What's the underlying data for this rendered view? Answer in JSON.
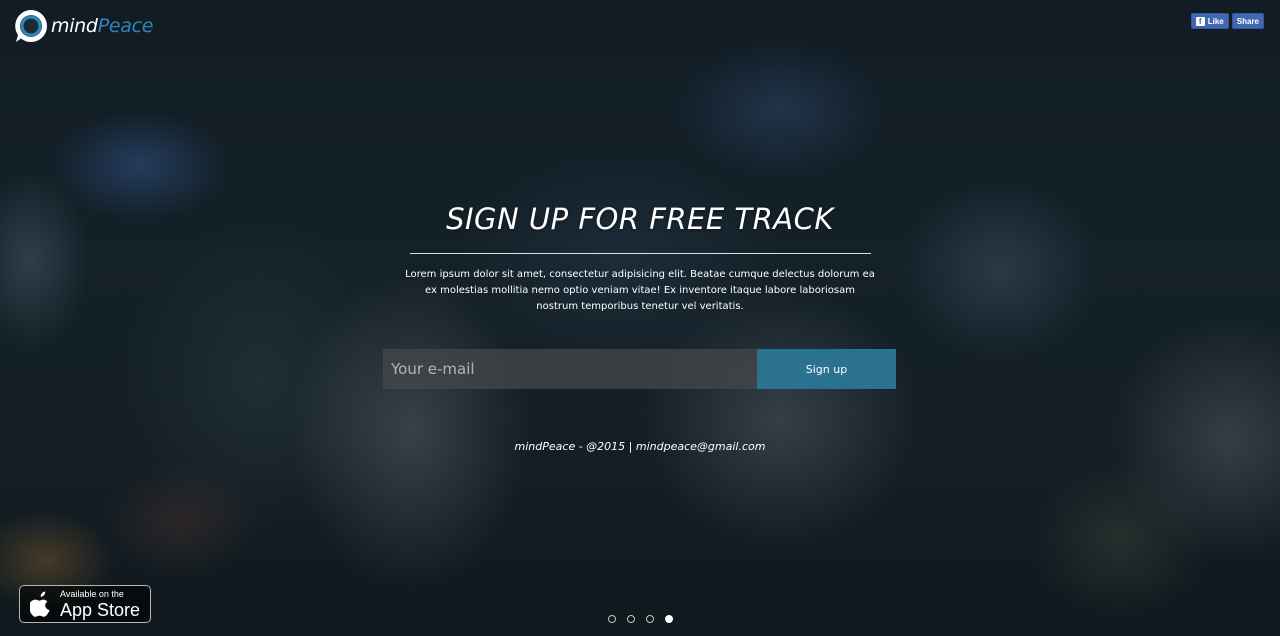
{
  "brand": {
    "name_part1": "mind",
    "name_part2": "Peace",
    "logo_icon": "speech-bubble-ring-logo",
    "accent_color": "#2e86b8"
  },
  "social": {
    "like_label": "Like",
    "share_label": "Share",
    "icon": "facebook-icon"
  },
  "hero": {
    "title": "SIGN UP FOR FREE TRACK",
    "body": "Lorem ipsum dolor sit amet, consectetur adipisicing elit. Beatae cumque delectus dolorum ea ex molestias mollitia nemo optio veniam vitae! Ex inventore itaque labore laboriosam nostrum temporibus tenetur vel veritatis."
  },
  "signup": {
    "email_placeholder": "Your e-mail",
    "email_value": "",
    "button_label": "Sign up",
    "button_color": "#2b7290"
  },
  "footer": {
    "text": "mindPeace - @2015 | mindpeace@gmail.com"
  },
  "appstore": {
    "small_text": "Available on the",
    "big_text": "App Store",
    "icon": "apple-icon"
  },
  "slider": {
    "count": 4,
    "active_index": 3
  }
}
